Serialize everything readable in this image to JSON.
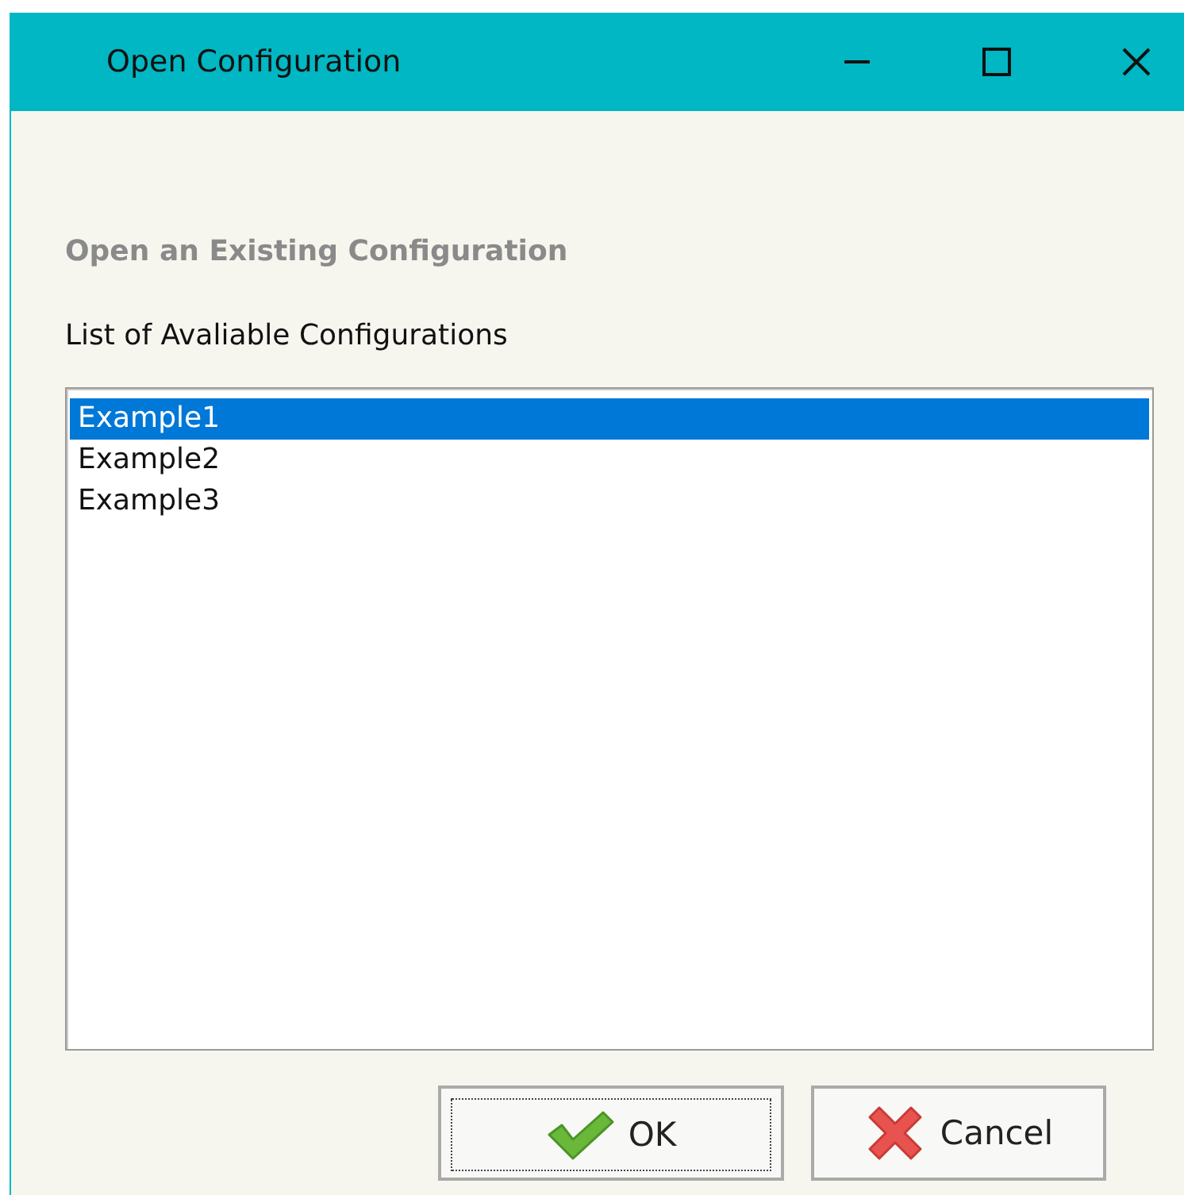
{
  "window": {
    "title": "Open Configuration"
  },
  "heading": "Open an Existing Configuration",
  "list_label": "List of Avaliable Configurations",
  "configurations": [
    {
      "name": "Example1",
      "selected": true
    },
    {
      "name": "Example2",
      "selected": false
    },
    {
      "name": "Example3",
      "selected": false
    }
  ],
  "buttons": [
    {
      "kind": "ok",
      "label": "OK"
    },
    {
      "kind": "cancel",
      "label": "Cancel"
    }
  ]
}
